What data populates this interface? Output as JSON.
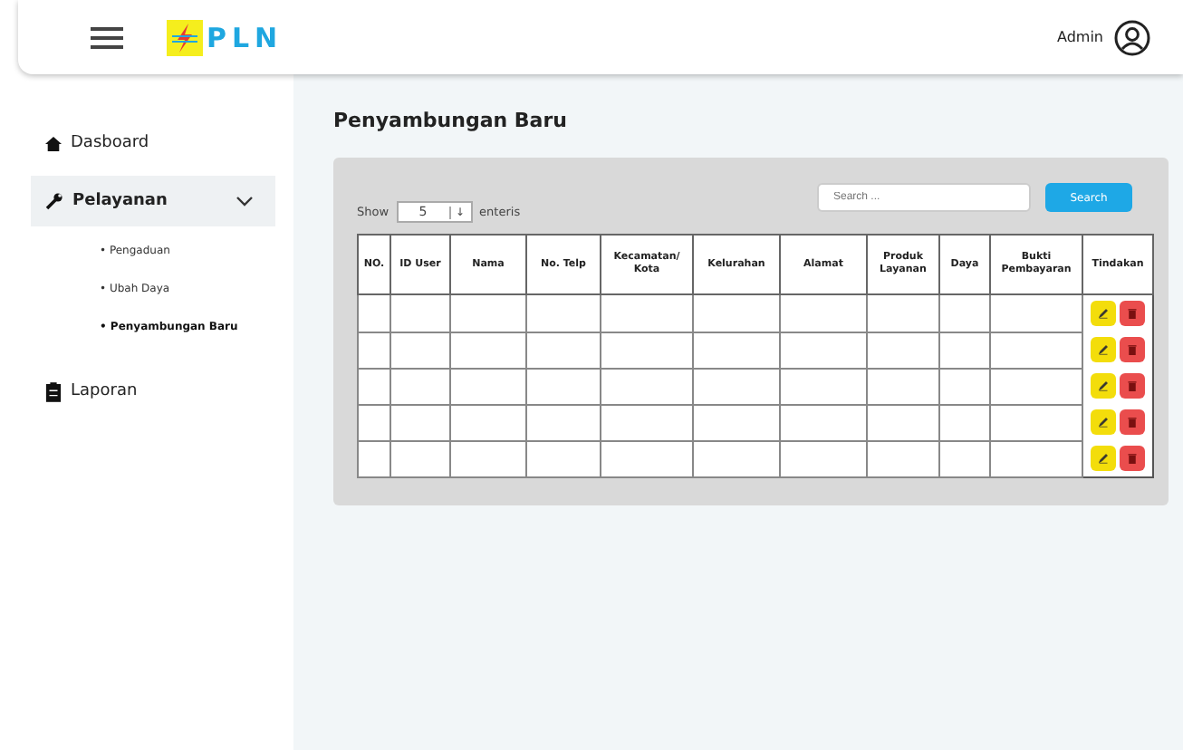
{
  "header": {
    "logo_text": "PLN",
    "user": "Admin"
  },
  "sidebar": {
    "items": [
      {
        "label": "Dasboard",
        "kind": "home",
        "expanded": false
      },
      {
        "label": "Pelayanan",
        "kind": "tools",
        "expanded": true,
        "children": [
          {
            "label": "• Pengaduan",
            "selected": false
          },
          {
            "label": "• Ubah Daya",
            "selected": false
          },
          {
            "label": "• Penyambungan Baru",
            "selected": true
          }
        ]
      },
      {
        "label": "Laporan",
        "kind": "report",
        "expanded": false
      }
    ]
  },
  "page": {
    "title": "Penyambungan Baru"
  },
  "controls": {
    "show_label": "Show",
    "entries_value": "5",
    "entries_arrow": "↓",
    "entries_label": "enteris",
    "search_placeholder": "Search ...",
    "search_button": "Search"
  },
  "table": {
    "columns": [
      "NO.",
      "ID User",
      "Nama",
      "No. Telp",
      "Kecamatan/ Kota",
      "Kelurahan",
      "Alamat",
      "Produk Layanan",
      "Daya",
      "Bukti Pembayaran",
      "Tindakan"
    ],
    "rows": [
      {
        "kind": "empty"
      },
      {
        "kind": "empty"
      },
      {
        "kind": "empty"
      },
      {
        "kind": "empty"
      },
      {
        "kind": "empty"
      }
    ]
  }
}
